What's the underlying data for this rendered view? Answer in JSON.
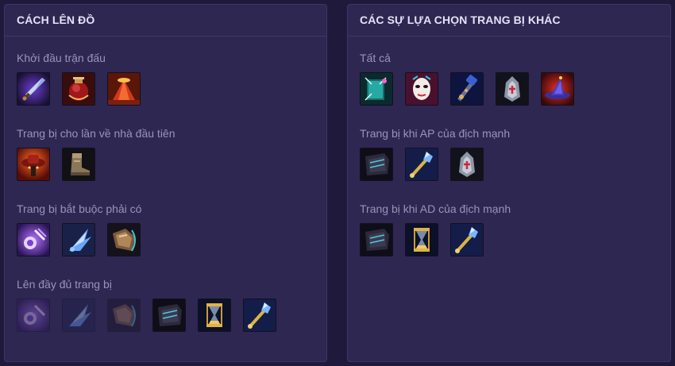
{
  "left_panel": {
    "title": "CÁCH LÊN ĐỒ",
    "sections": [
      {
        "title": "Khởi đầu trận đấu",
        "items": [
          "dagger-item-icon",
          "crimson-potion-item-icon",
          "red-totem-item-icon"
        ]
      },
      {
        "title": "Trang bị cho lần về nhà đầu tiên",
        "items": [
          "red-hat-item-icon",
          "boots-item-icon"
        ]
      },
      {
        "title": "Trang bị bắt buộc phải có",
        "items": [
          "purple-orb-item-icon",
          "blue-wing-item-icon",
          "armored-gauntlet-item-icon"
        ]
      },
      {
        "title": "Lên đầy đủ trang bị",
        "items": [
          "purple-orb-item-icon",
          "blue-wing-item-icon",
          "armored-gauntlet-item-icon",
          "dark-plate-item-icon",
          "hourglass-item-icon",
          "crystal-scepter-item-icon"
        ]
      }
    ]
  },
  "right_panel": {
    "title": "CÁC SỰ LỰA CHỌN TRANG BỊ KHÁC",
    "sections": [
      {
        "title": "Tất cả",
        "items": [
          "teal-book-item-icon",
          "white-mask-item-icon",
          "blue-staff-item-icon",
          "silver-helm-item-icon",
          "witch-hat-item-icon"
        ]
      },
      {
        "title": "Trang bị khi AP của địch mạnh",
        "items": [
          "dark-plate-item-icon",
          "crystal-scepter-item-icon",
          "silver-helm-item-icon"
        ]
      },
      {
        "title": "Trang bị khi AD của địch mạnh",
        "items": [
          "dark-plate-item-icon",
          "hourglass-item-icon",
          "crystal-scepter-item-icon"
        ]
      }
    ]
  }
}
